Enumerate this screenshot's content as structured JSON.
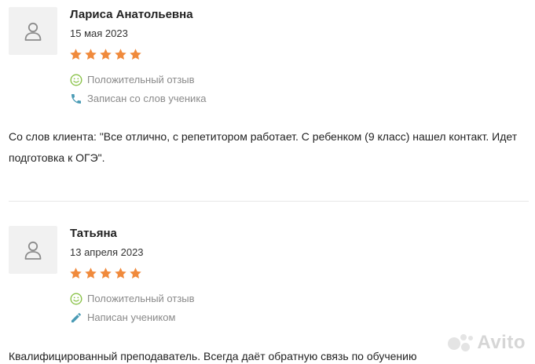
{
  "reviews": [
    {
      "author": "Лариса Анатольевна",
      "date": "15 мая 2023",
      "rating": 5,
      "sentiment": "Положительный отзыв",
      "source": "Записан со слов ученика",
      "text": "Со слов клиента: \"Все отлично, с репетитором работает. С ребенком (9 класс) нашел контакт. Идет подготовка к ОГЭ\"."
    },
    {
      "author": "Татьяна",
      "date": "13 апреля 2023",
      "rating": 5,
      "sentiment": "Положительный отзыв",
      "source": "Написан учеником",
      "text": "Квалифицированный преподаватель. Всегда даёт обратную связь по обучению"
    }
  ],
  "watermark": "Avito",
  "colors": {
    "star": "#f08a3c",
    "positive_icon": "#8bc34a",
    "source_icon": "#4a9bb5",
    "meta_text": "#8a8a8a"
  },
  "icons": {
    "avatar": "user-icon",
    "sentiment": "smile-icon",
    "source_1": "phone-icon",
    "source_2": "pencil-icon"
  }
}
